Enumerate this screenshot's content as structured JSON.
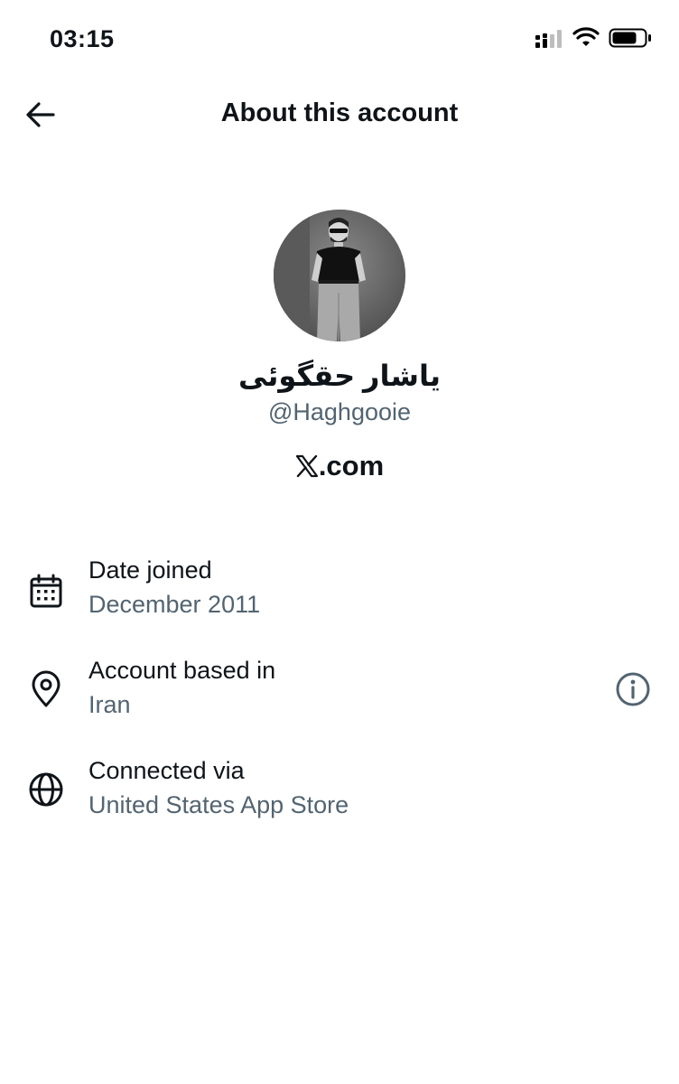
{
  "status_bar": {
    "time": "03:15"
  },
  "header": {
    "title": "About this account"
  },
  "profile": {
    "display_name": "یاشار حقگوئی",
    "handle": "@Haghgooie",
    "brand": ".com"
  },
  "details": {
    "date_joined": {
      "label": "Date joined",
      "value": "December 2011",
      "icon": "calendar-icon"
    },
    "account_based": {
      "label": "Account based in",
      "value": "Iran",
      "icon": "location-pin-icon"
    },
    "connected_via": {
      "label": "Connected via",
      "value": "United States App Store",
      "icon": "globe-icon"
    }
  },
  "colors": {
    "text": "#0f1419",
    "secondary": "#536471",
    "background": "#ffffff"
  }
}
